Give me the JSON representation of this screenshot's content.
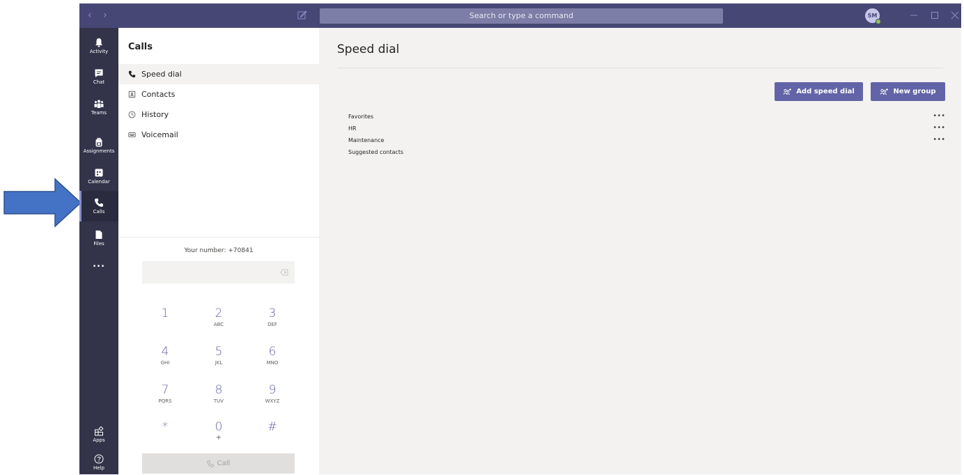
{
  "titlebar": {
    "search_placeholder": "Search or type a command",
    "avatar_initials": "SM",
    "nav_back_glyph": "‹",
    "nav_forward_glyph": "›"
  },
  "rail": {
    "items": [
      {
        "label": "Activity",
        "icon": "bell-icon"
      },
      {
        "label": "Chat",
        "icon": "chat-icon"
      },
      {
        "label": "Teams",
        "icon": "teams-icon"
      },
      {
        "label": "Assignments",
        "icon": "backpack-icon"
      },
      {
        "label": "Calendar",
        "icon": "calendar-icon"
      },
      {
        "label": "Calls",
        "icon": "phone-icon",
        "active": true
      },
      {
        "label": "Files",
        "icon": "file-icon"
      },
      {
        "label": "...",
        "icon": "more-icon"
      }
    ],
    "apps_label": "Apps",
    "help_label": "Help"
  },
  "calls_panel": {
    "title": "Calls",
    "nav": [
      {
        "label": "Speed dial",
        "icon": "phone-icon",
        "active": true
      },
      {
        "label": "Contacts",
        "icon": "contact-card-icon"
      },
      {
        "label": "History",
        "icon": "clock-icon"
      },
      {
        "label": "Voicemail",
        "icon": "voicemail-icon"
      }
    ],
    "your_number": "Your number: +70841",
    "dial_value": "",
    "keys": [
      {
        "digit": "1",
        "letters": ""
      },
      {
        "digit": "2",
        "letters": "ABC"
      },
      {
        "digit": "3",
        "letters": "DEF"
      },
      {
        "digit": "4",
        "letters": "GHI"
      },
      {
        "digit": "5",
        "letters": "JKL"
      },
      {
        "digit": "6",
        "letters": "MNO"
      },
      {
        "digit": "7",
        "letters": "PQRS"
      },
      {
        "digit": "8",
        "letters": "TUV"
      },
      {
        "digit": "9",
        "letters": "WXYZ"
      },
      {
        "digit": "*",
        "letters": ""
      },
      {
        "digit": "0",
        "letters": "+"
      },
      {
        "digit": "#",
        "letters": ""
      }
    ],
    "call_label": "Call"
  },
  "main": {
    "title": "Speed dial",
    "add_speed_dial_label": "Add speed dial",
    "new_group_label": "New group",
    "groups": [
      {
        "name": "Favorites",
        "more": "•••"
      },
      {
        "name": "HR",
        "more": "•••"
      },
      {
        "name": "Maintenance",
        "more": "•••"
      },
      {
        "name": "Suggested contacts",
        "more": ""
      }
    ]
  },
  "colors": {
    "titlebar": "#464775",
    "rail": "#33344a",
    "accent": "#6264a7",
    "arrow": "#4472c4"
  }
}
